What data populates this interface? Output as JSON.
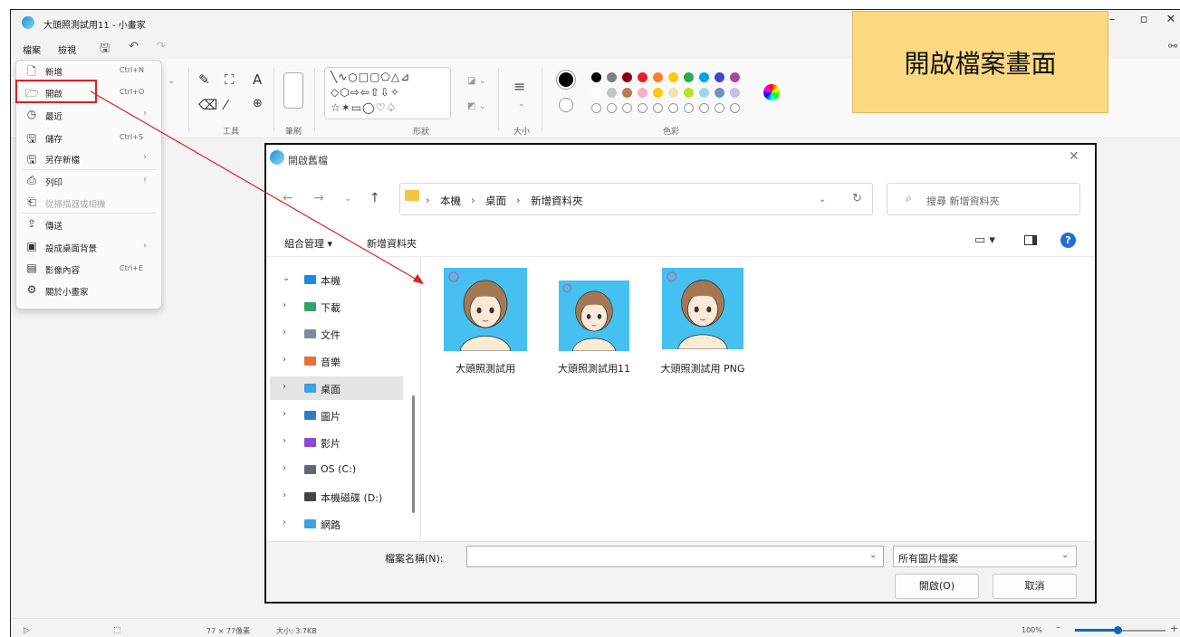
{
  "window": {
    "title": "大頭照測試用11 - 小畫家"
  },
  "menubar": {
    "file": "檔案",
    "view": "檢視"
  },
  "ribbon": {
    "tools_label": "工具",
    "brush_label": "筆刷",
    "shapes_label": "形狀",
    "size_label": "大小",
    "colors_label": "色彩",
    "shapes_row1": "╲∿○□▢⬠△⊿",
    "shapes_row2": "◇⬡⇨⇦⇧⇩✧",
    "shapes_row3": "☆✶▭◯♡♤",
    "colors_row1": [
      "#000000",
      "#7f7f7f",
      "#880015",
      "#ed1c24",
      "#ff7f27",
      "#ffc90e",
      "#22b14c",
      "#00a2e8",
      "#3f48cc",
      "#a349a4"
    ],
    "colors_row2": [
      "#ffffff",
      "#c3c3c3",
      "#b97a57",
      "#ffaec9",
      "#ffc90e",
      "#efe4b0",
      "#b5e61d",
      "#99d9ea",
      "#7092be",
      "#c8bfe7"
    ]
  },
  "file_menu": {
    "items": [
      {
        "icon": "🗋",
        "label": "新增",
        "shortcut": "Ctrl+N",
        "arrow": ""
      },
      {
        "icon": "🗁",
        "label": "開啟",
        "shortcut": "Ctrl+O",
        "arrow": ""
      },
      {
        "icon": "◷",
        "label": "最近",
        "shortcut": "",
        "arrow": "›"
      },
      {
        "icon": "🖫",
        "label": "儲存",
        "shortcut": "Ctrl+S",
        "arrow": ""
      },
      {
        "icon": "🖫",
        "label": "另存新檔",
        "shortcut": "",
        "arrow": "›"
      },
      {
        "icon": "⎙",
        "label": "列印",
        "shortcut": "",
        "arrow": "›"
      },
      {
        "icon": "⎗",
        "label": "從掃描器或相機",
        "shortcut": "",
        "arrow": ""
      },
      {
        "icon": "⇪",
        "label": "傳送",
        "shortcut": "",
        "arrow": ""
      },
      {
        "icon": "▣",
        "label": "設成桌面背景",
        "shortcut": "",
        "arrow": "›"
      },
      {
        "icon": "▤",
        "label": "影像內容",
        "shortcut": "Ctrl+E",
        "arrow": ""
      },
      {
        "icon": "⚙",
        "label": "關於小畫家",
        "shortcut": "",
        "arrow": ""
      }
    ]
  },
  "callout": {
    "text": "開啟檔案畫面"
  },
  "dialog": {
    "title": "開啟舊檔",
    "breadcrumb": [
      "本機",
      "桌面",
      "新增資料夾"
    ],
    "search_placeholder": "搜尋 新增資料夾",
    "organize": "組合管理 ▾",
    "new_folder": "新增資料夾",
    "tree": [
      {
        "label": "本機",
        "chev": "⌄",
        "color": "#1e88e5"
      },
      {
        "label": "下載",
        "chev": "›",
        "color": "#2fa36b"
      },
      {
        "label": "文件",
        "chev": "›",
        "color": "#7a8ca0"
      },
      {
        "label": "音樂",
        "chev": "›",
        "color": "#e8703a"
      },
      {
        "label": "桌面",
        "chev": "›",
        "color": "#3ba3e0"
      },
      {
        "label": "圖片",
        "chev": "›",
        "color": "#2f7ad0"
      },
      {
        "label": "影片",
        "chev": "›",
        "color": "#8a4bd6"
      },
      {
        "label": "OS (C:)",
        "chev": "›",
        "color": "#5a6a7a"
      },
      {
        "label": "本機磁碟 (D:)",
        "chev": "›",
        "color": "#444444"
      },
      {
        "label": "網路",
        "chev": "›",
        "color": "#3ba3e0"
      }
    ],
    "files": [
      {
        "name": "大頭照測試用"
      },
      {
        "name": "大頭照測試用11"
      },
      {
        "name": "大頭照測試用 PNG"
      }
    ],
    "filename_label": "檔案名稱(N):",
    "filename_value": "",
    "filter": "所有圖片檔案",
    "open_button": "開啟(O)",
    "cancel_button": "取消"
  },
  "statusbar": {
    "dimensions": "77 × 77像素",
    "size": "大小: 3.7KB",
    "zoom": "100%"
  }
}
